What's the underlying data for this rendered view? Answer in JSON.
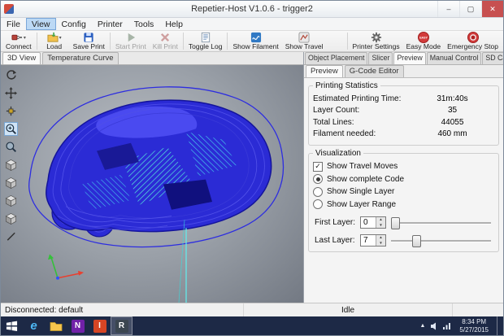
{
  "window": {
    "title": "Repetier-Host V1.0.6 - trigger2",
    "controls": {
      "minimize": "–",
      "maximize": "▢",
      "close": "✕"
    }
  },
  "menu": {
    "items": [
      {
        "label": "File"
      },
      {
        "label": "View",
        "active": true
      },
      {
        "label": "Config"
      },
      {
        "label": "Printer"
      },
      {
        "label": "Tools"
      },
      {
        "label": "Help"
      }
    ]
  },
  "toolbar": {
    "dropdown_glyph": "▾",
    "easy_badge": "EASY",
    "buttons": {
      "connect": "Connect",
      "load": "Load",
      "save_print": "Save Print",
      "start_print": "Start Print",
      "kill_print": "Kill Print",
      "toggle_log": "Toggle Log",
      "show_filament": "Show Filament",
      "show_travel": "Show Travel",
      "printer_settings": "Printer Settings",
      "easy_mode": "Easy Mode",
      "emergency_stop": "Emergency Stop"
    }
  },
  "left_panel": {
    "tabs": {
      "view3d": "3D View",
      "temperature": "Temperature Curve"
    }
  },
  "right_panel": {
    "tabs": {
      "object_placement": "Object Placement",
      "slicer": "Slicer",
      "preview": "Preview",
      "manual_control": "Manual Control",
      "sd_card": "SD Card"
    },
    "subtabs": {
      "preview": "Preview",
      "gcode": "G-Code Editor"
    },
    "stats": {
      "title": "Printing Statistics",
      "rows": [
        {
          "label": "Estimated Printing Time:",
          "value": "31m:40s"
        },
        {
          "label": "Layer Count:",
          "value": "35"
        },
        {
          "label": "Total Lines:",
          "value": "44055"
        },
        {
          "label": "Filament needed:",
          "value": "460 mm"
        }
      ]
    },
    "visualization": {
      "title": "Visualization",
      "check_glyph": "✓",
      "options": [
        {
          "label": "Show Travel Moves",
          "type": "checkbox",
          "checked": true
        },
        {
          "label": "Show complete Code",
          "type": "radio",
          "checked": true
        },
        {
          "label": "Show Single Layer",
          "type": "radio",
          "checked": false
        },
        {
          "label": "Show Layer Range",
          "type": "radio",
          "checked": false
        }
      ],
      "first_layer": {
        "label": "First Layer:",
        "value": "0"
      },
      "last_layer": {
        "label": "Last Layer:",
        "value": "7"
      }
    }
  },
  "glyphs": {
    "spin_up": "▲",
    "spin_down": "▼",
    "tray_arrow": "▲"
  },
  "statusbar": {
    "connection": "Disconnected: default",
    "state": "Idle"
  },
  "taskbar": {
    "apps": [
      {
        "glyph": "e"
      },
      {
        "glyph": ""
      },
      {
        "glyph": "N"
      },
      {
        "glyph": "I"
      },
      {
        "glyph": "R",
        "active": true
      }
    ],
    "clock": {
      "time": "8:34 PM",
      "date": "5/27/2015"
    }
  },
  "colors": {
    "model_blue": "#2b2bd5",
    "infill_cyan": "#55e8da",
    "taskbar_navy": "#1d2946",
    "close_red": "#c75050",
    "easy_red": "#d23b3b",
    "menu_highlight": "#bcd9f5"
  }
}
